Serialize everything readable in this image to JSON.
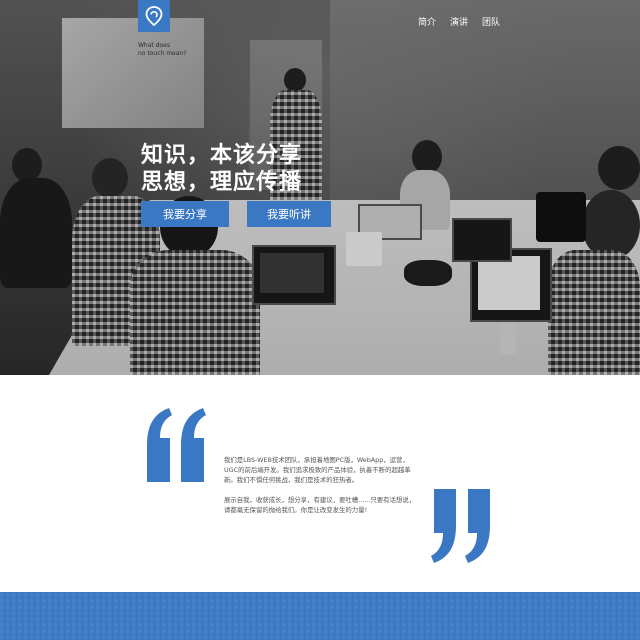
{
  "nav": {
    "items": [
      {
        "label": "简介"
      },
      {
        "label": "演讲"
      },
      {
        "label": "团队"
      }
    ]
  },
  "hero": {
    "headline_line1": "知识，本该分享",
    "headline_line2": "思想，理应传播",
    "share_button": "我要分享",
    "listen_button": "我要听讲",
    "projection_text_1": "What does",
    "projection_text_2": "no touch mean?"
  },
  "intro": {
    "paragraph1": "我们是LBS-WEB技术团队，承担着地图PC版，WebApp，运营，UGC的前后端开发。我们追求极致的产品体验，执着不断的超越革新。我们不惧任何挑战，我们是技术的狂热者。",
    "paragraph2": "展示自我，收获成长，想分享，有建议，要吐槽......只要有话想说，请都毫无保留的抛给我们。你是让改变发生的力量!"
  },
  "colors": {
    "accent": "#3b78c4"
  }
}
